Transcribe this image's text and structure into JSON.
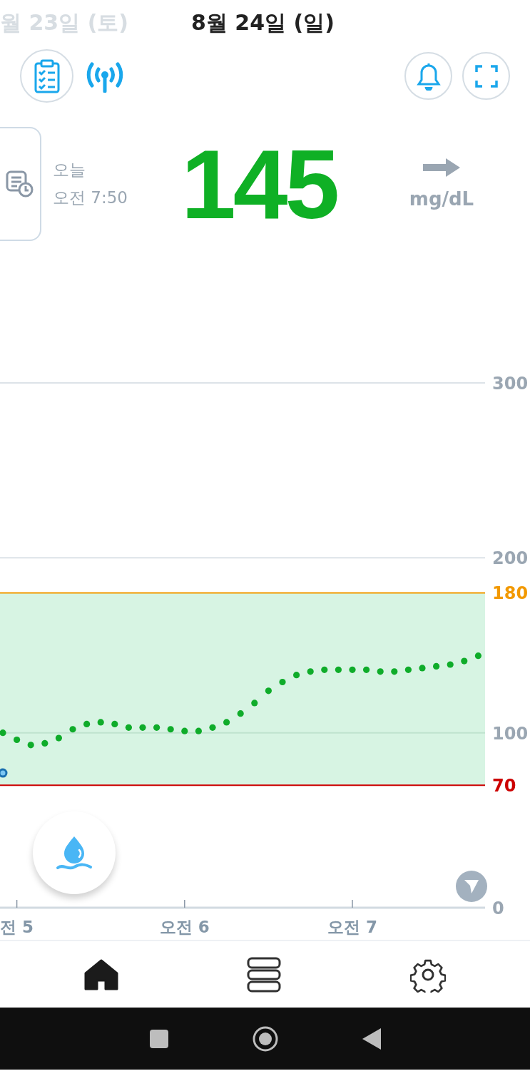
{
  "header": {
    "previous_date": "월 23일 (토)",
    "date": "8월 24일 (일)"
  },
  "reading": {
    "day": "오늘",
    "time": "오전 7:50",
    "value": "145",
    "unit": "mg/dL"
  },
  "chart": {
    "chart_data": {
      "type": "scatter",
      "ylim": [
        0,
        300
      ],
      "categories": [
        null,
        "전 5",
        null,
        null,
        null,
        null,
        null,
        null,
        null,
        null,
        null,
        null,
        null,
        "오전 6",
        null,
        null,
        null,
        null,
        null,
        null,
        null,
        null,
        null,
        null,
        null,
        "오전 7",
        null,
        null,
        null,
        null,
        null,
        null,
        null,
        null,
        null
      ],
      "yticks": [
        0,
        70,
        100,
        180,
        200,
        300
      ],
      "ref_lines": [
        {
          "axis": "y",
          "value": 300,
          "color": "#dde3e8"
        },
        {
          "axis": "y",
          "value": 200,
          "color": "#dde3e8"
        },
        {
          "axis": "y",
          "value": 180,
          "color": "#f29900"
        },
        {
          "axis": "y",
          "value": 100,
          "color": "#bfe3cf"
        },
        {
          "axis": "y",
          "value": 70,
          "color": "#cc0000"
        }
      ],
      "bands": [
        {
          "axis": "y",
          "from": 70,
          "to": 180,
          "color": "#d7f4e3"
        }
      ],
      "series": [
        {
          "color": "#0fac2a",
          "values": [
            100,
            96,
            93,
            94,
            97,
            102,
            105,
            106,
            105,
            103,
            103,
            103,
            102,
            101,
            101,
            103,
            106,
            111,
            117,
            124,
            129,
            133,
            135,
            136,
            136,
            136,
            136,
            135,
            135,
            136,
            137,
            138,
            139,
            141,
            144
          ]
        },
        {
          "color": "#1a6fb0",
          "values": [
            77,
            null,
            null,
            null,
            null,
            null,
            null,
            null,
            null,
            null,
            null,
            null,
            null,
            null,
            null,
            null,
            null,
            null,
            null,
            null,
            null,
            null,
            null,
            null,
            null,
            null,
            null,
            null,
            null,
            null,
            null,
            null,
            null,
            null,
            null
          ]
        }
      ]
    }
  },
  "nav": [
    {
      "selected": true
    },
    {
      "selected": false
    },
    {
      "selected": false
    }
  ]
}
